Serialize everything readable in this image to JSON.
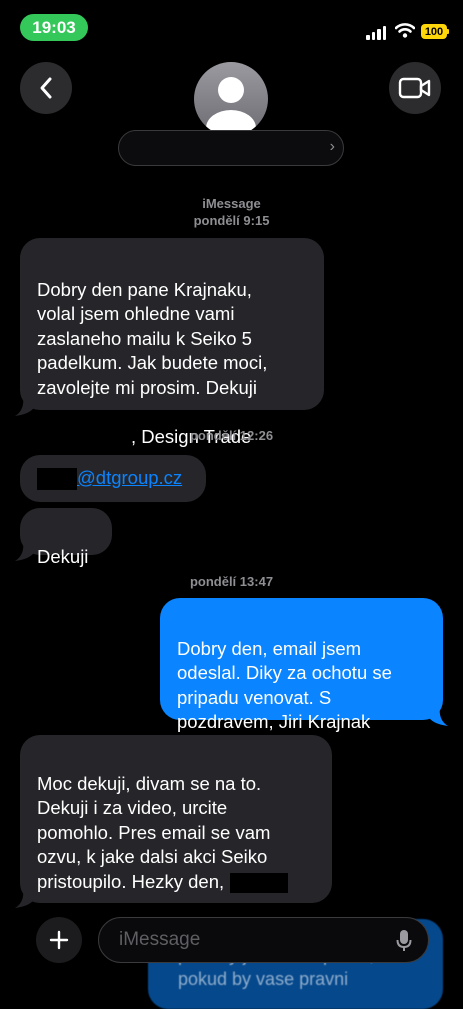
{
  "status_bar": {
    "time": "19:03",
    "battery": "100"
  },
  "header": {
    "contact_name": ""
  },
  "thread": {
    "service": "iMessage",
    "timestamps": [
      {
        "day": "pondělí",
        "time": "9:15"
      },
      {
        "day": "pondělí",
        "time": "12:26"
      },
      {
        "day": "pondělí",
        "time": "13:47"
      }
    ],
    "messages": [
      {
        "direction": "incoming",
        "text": "Dobry den pane Krajnaku,\nvolal jsem ohledne vami\nzaslaneho mailu k Seiko 5\npadelkum. Jak budete moci,\nzavolejte mi prosim. Dekuji",
        "tail": ", Design Trade"
      },
      {
        "direction": "incoming",
        "link": "@dtgroup.cz"
      },
      {
        "direction": "incoming",
        "text": "Dekuji"
      },
      {
        "direction": "outgoing",
        "text": "Dobry den, email jsem\nodeslal. Diky za ochotu se\npripadu venovat. S\npozdravem, Jiri Krajnak"
      },
      {
        "direction": "incoming",
        "text": "Moc dekuji, divam se na to.\nDekuji i za video, urcite\npomohlo. Pres email se vam\nozvu, k jake dalsi akci Seiko\npristoupilo. Hezky den,"
      }
    ]
  },
  "composer": {
    "placeholder": "iMessage",
    "ghost_text": "potreby jsem k dispozici,\npokud by vase pravni"
  },
  "colors": {
    "incoming_bubble": "#26262a",
    "outgoing_bubble": "#0a84ff",
    "link": "#0a84ff",
    "time_pill": "#34c759",
    "battery": "#ffd60a"
  },
  "icons": [
    "back-chevron-icon",
    "video-call-icon",
    "person-avatar-icon",
    "plus-icon",
    "microphone-icon",
    "signal-icon",
    "wifi-icon",
    "battery-icon"
  ]
}
